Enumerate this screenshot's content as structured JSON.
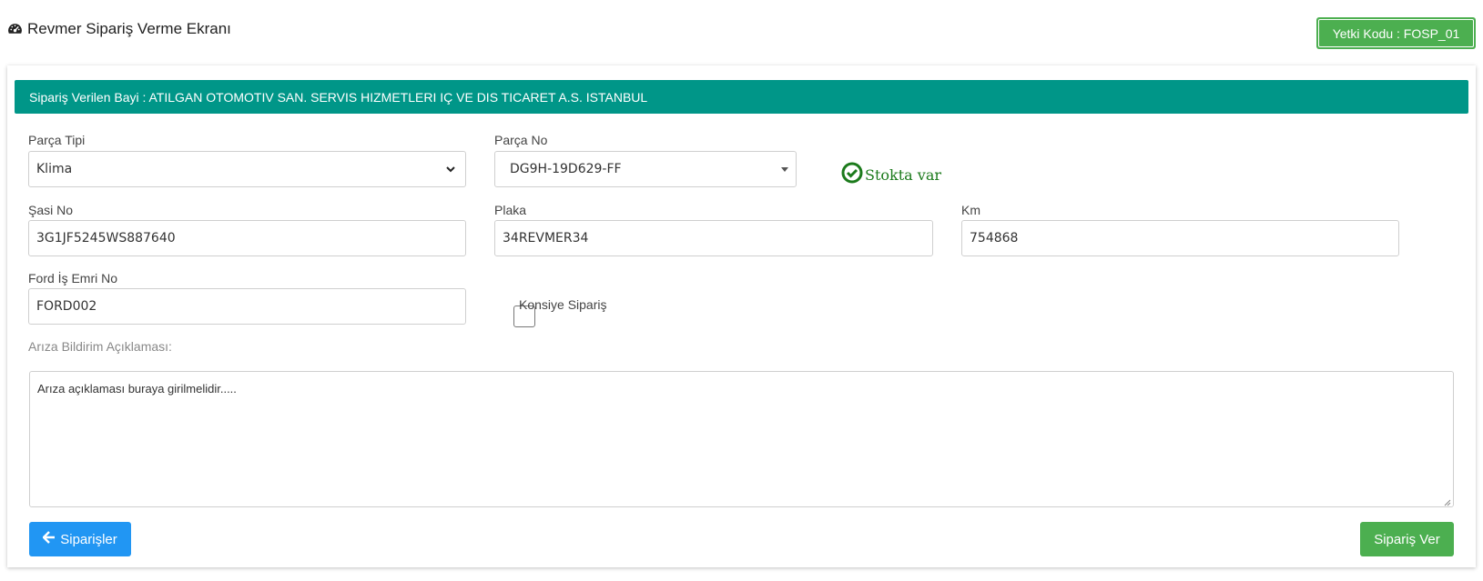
{
  "header": {
    "title": "Revmer Sipariş Verme Ekranı",
    "title_icon": "tachometer-icon",
    "auth_code": "Yetki Kodu : FOSP_01"
  },
  "dealer": {
    "text": "Sipariş Verilen Bayi : ATILGAN OTOMOTIV SAN. SERVIS HIZMETLERI IÇ VE DIS TICARET A.S. ISTANBUL"
  },
  "form": {
    "part_type": {
      "label": "Parça Tipi",
      "value": "Klima"
    },
    "part_no": {
      "label": "Parça No",
      "value": "DG9H-19D629-FF"
    },
    "stock_status": {
      "text": "Stokta var",
      "icon": "check-circle-icon",
      "color": "#1b7a1b"
    },
    "chassis_no": {
      "label": "Şasi No",
      "value": "3G1JF5245WS887640"
    },
    "plate": {
      "label": "Plaka",
      "value": "34REVMER34"
    },
    "km": {
      "label": "Km",
      "value": "754868"
    },
    "ford_work_order": {
      "label": "Ford İş Emri No",
      "value": "FORD002"
    },
    "consignment": {
      "label": "Konsiye Sipariş",
      "checked": false
    },
    "fault_description": {
      "label": "Arıza Bildirim Açıklaması:",
      "value": "Arıza açıklaması buraya girilmelidir....."
    }
  },
  "buttons": {
    "back_label": "Siparişler",
    "back_icon": "arrow-left-icon",
    "order_label": "Sipariş Ver"
  },
  "colors": {
    "dealer_bar": "#009688",
    "badge": "#4caf50",
    "back_button": "#2196f3",
    "order_button": "#4caf50"
  }
}
